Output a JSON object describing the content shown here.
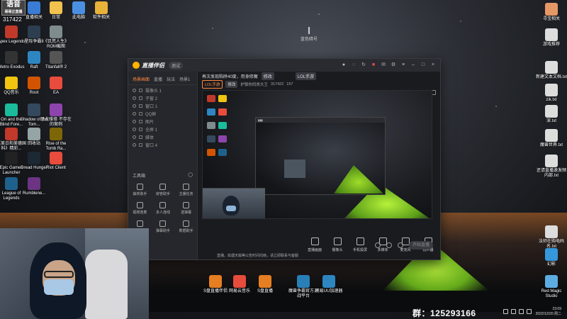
{
  "top_left": {
    "logo": "语音",
    "logo_sub": "哥哥正直播",
    "room_number": "317422"
  },
  "desktop_left": [
    {
      "label": "直播相关",
      "color": "#3a7bd5"
    },
    {
      "label": "日常",
      "color": "#f2c14e"
    },
    {
      "label": "此电脑",
      "color": "#4a90e2"
    },
    {
      "label": "软件相关",
      "color": "#e8b339"
    },
    {
      "label": "Apex Legends",
      "color": "#c0392b"
    },
    {
      "label": "星际争霸II",
      "color": "#2c3e50"
    },
    {
      "label": "《饥荒人生》ROM截图",
      "color": "#7f8c8d"
    },
    {
      "label": "Metro Exodus",
      "color": "#333"
    },
    {
      "label": "Raft",
      "color": "#2e86c1"
    },
    {
      "label": "Titanfall® 2",
      "color": "#555"
    },
    {
      "label": "QQ音乐",
      "color": "#f1c40f"
    },
    {
      "label": "Root",
      "color": "#d35400"
    },
    {
      "label": "EA",
      "color": "#e74c3c"
    },
    {
      "label": "Ori and the Blind Fore...",
      "color": "#1abc9c"
    },
    {
      "label": "Shadow of the Tom...",
      "color": "#34495e"
    },
    {
      "label": "恐龙维修 不存在的案例",
      "color": "#8e44ad"
    },
    {
      "label": "《美日和美德国科》精彩...",
      "color": "#c0392b"
    },
    {
      "label": "回收站",
      "color": "#95a5a6"
    },
    {
      "label": "Rise of the Tomb Ra...",
      "color": "#7d6608"
    },
    {
      "label": "Epic Games Launcher",
      "color": "#222"
    },
    {
      "label": "Dread Hunger",
      "color": "#1c2833"
    },
    {
      "label": "Riot Client",
      "color": "#e74c3c"
    },
    {
      "label": "League of Legends",
      "color": "#1f618d"
    },
    {
      "label": "Rumblene...",
      "color": "#6c3483"
    }
  ],
  "desktop_right": [
    {
      "label": "寻宝相关",
      "color": "#e59866"
    },
    {
      "label": "游戏推荐",
      "color": "#ddd"
    },
    {
      "label": "新建文本文档.txt",
      "color": "#ddd"
    },
    {
      "label": "zik.txt",
      "color": "#ddd"
    },
    {
      "label": "深.txt",
      "color": "#ddd"
    },
    {
      "label": "魔兽世界.txt",
      "color": "#ddd"
    },
    {
      "label": "还请直播速发频内部.txt",
      "color": "#ddd"
    },
    {
      "label": "法师在购电码名.txt",
      "color": "#ddd"
    },
    {
      "label": "幻影",
      "color": "#3498db"
    },
    {
      "label": "Red Magic Studio",
      "color": "#5dade2"
    }
  ],
  "desktop_bottom": [
    {
      "label": "S盘直播伴侣",
      "color": "#e67e22"
    },
    {
      "label": "网易云音乐",
      "color": "#e74c3c"
    },
    {
      "label": "S盘直播",
      "color": "#e67e22"
    },
    {
      "label": "魔兽争霸官方对战平台",
      "color": "#2980b9"
    },
    {
      "label": "网易UU加速器",
      "color": "#2e86c1"
    }
  ],
  "center_brand": "蓝色暗号",
  "app": {
    "title": "直播伴侣",
    "version_badge": "测试",
    "sidebar_tabs": [
      "场景画面",
      "直播",
      "玩法",
      "场景1"
    ],
    "scenes": [
      "摄像头 1",
      "子窗 2",
      "窗口 1",
      "QQ群",
      "图片",
      "全屏 1",
      "媒体",
      "窗口 4"
    ],
    "tools_title": "工具箱",
    "tools": [
      "抽奖助手",
      "房管助手",
      "主播任务",
      "视频连麦",
      "多人连线",
      "送弹幕",
      "直播间",
      "弹幕助手",
      "数据助手"
    ],
    "room_title": "再次发现陷阱40度，用身修魔",
    "room_tag": "修改",
    "room_category": "LOL手游",
    "room_row2": [
      "LOL手游",
      "修改",
      "护锁你同类大王",
      "317422",
      "157"
    ],
    "controls": [
      "直播画面",
      "摄像头",
      "手机投屏",
      "多媒体",
      "麦克风",
      "扬声器"
    ],
    "start_btn": "开始直播",
    "status_text": "直播，如遇天敌等公告时间向她，请立即联系与客服"
  },
  "taskbar": {
    "group": "群：125293166",
    "time": "23:09",
    "date": "2022/12/20 周二"
  }
}
